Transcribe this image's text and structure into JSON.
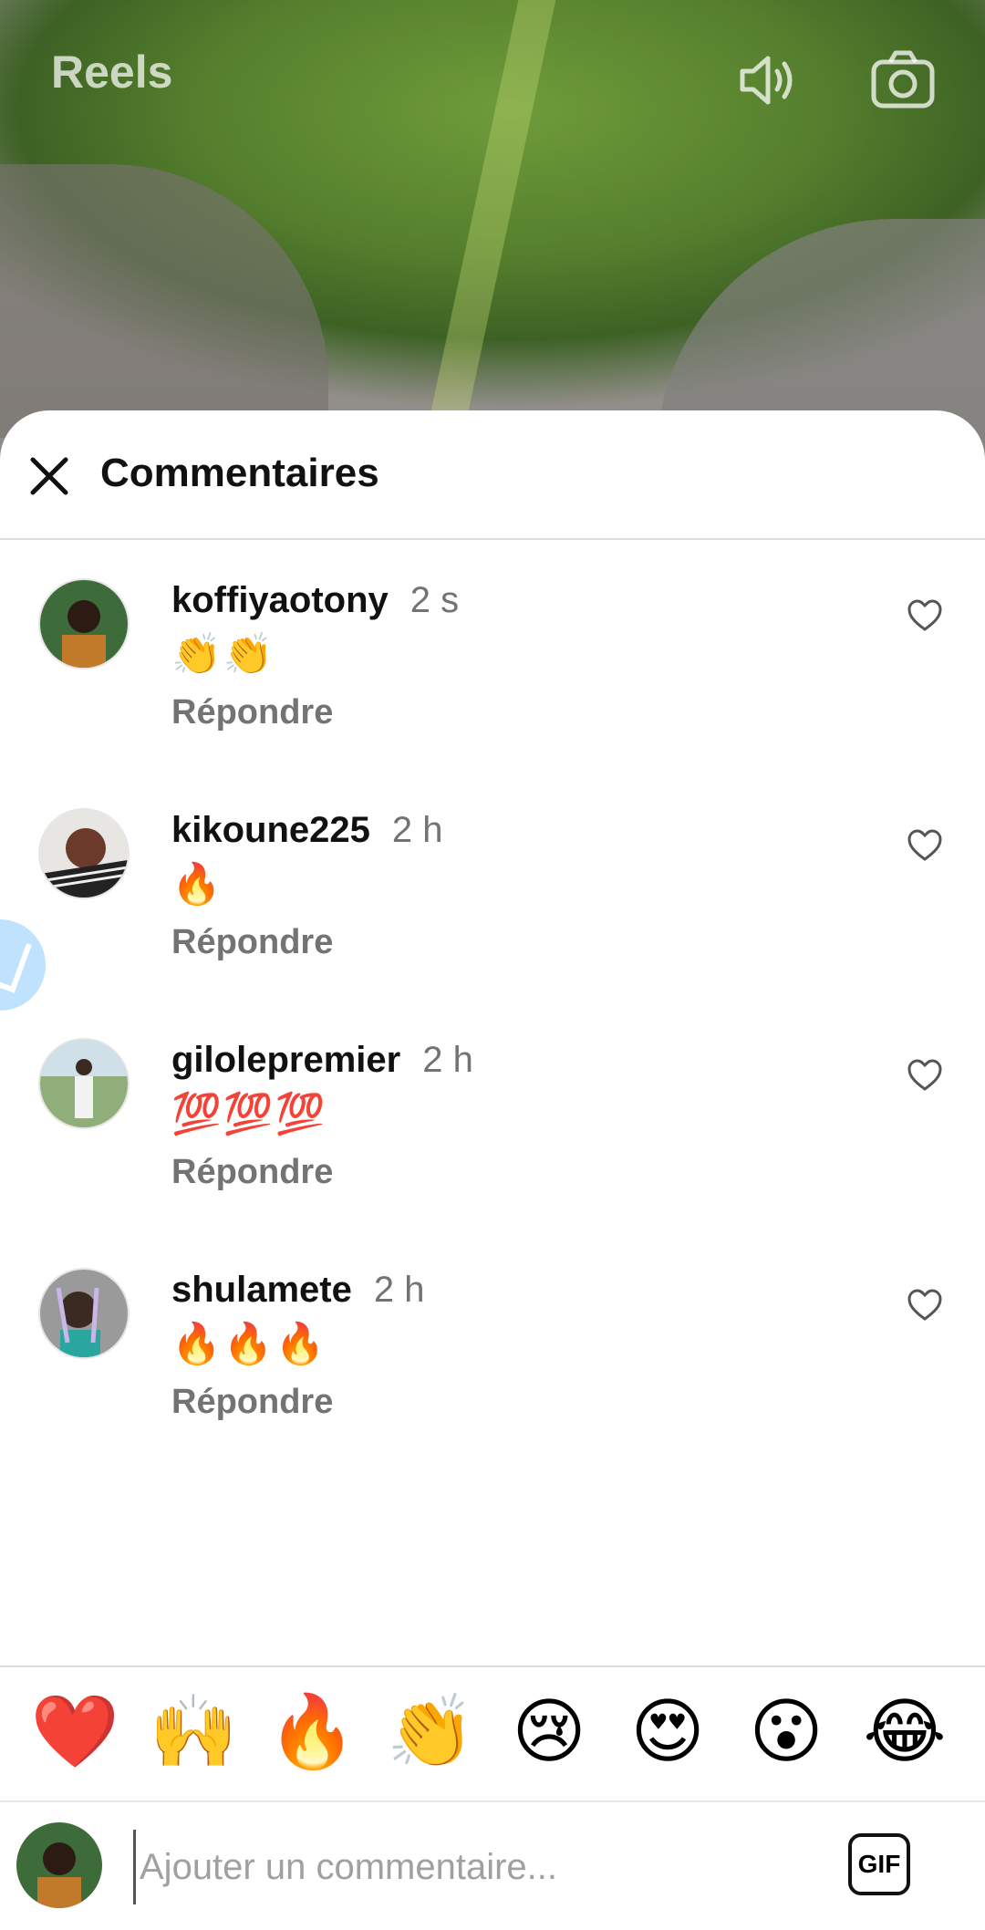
{
  "reels": {
    "title": "Reels"
  },
  "sheet": {
    "title": "Commentaires"
  },
  "comments": [
    {
      "user": "koffiyaotony",
      "time": "2 s",
      "text": "👏👏",
      "reply": "Répondre"
    },
    {
      "user": "kikoune225",
      "time": "2 h",
      "text": "🔥",
      "reply": "Répondre"
    },
    {
      "user": "gilolepremier",
      "time": "2 h",
      "text": "💯💯💯",
      "reply": "Répondre"
    },
    {
      "user": "shulamete",
      "time": "2 h",
      "text": "🔥🔥🔥",
      "reply": "Répondre"
    }
  ],
  "reactions": [
    "❤️",
    "🙌",
    "🔥",
    "👏",
    "😢",
    "😍",
    "😮",
    "😂"
  ],
  "compose": {
    "placeholder": "Ajouter un commentaire...",
    "gif_label": "GIF"
  },
  "icons": [
    "sound-icon",
    "camera-icon",
    "close-icon",
    "heart-outline-icon"
  ],
  "colors": {
    "muted": "#737373",
    "divider": "#dcdcdc",
    "text": "#111111"
  }
}
